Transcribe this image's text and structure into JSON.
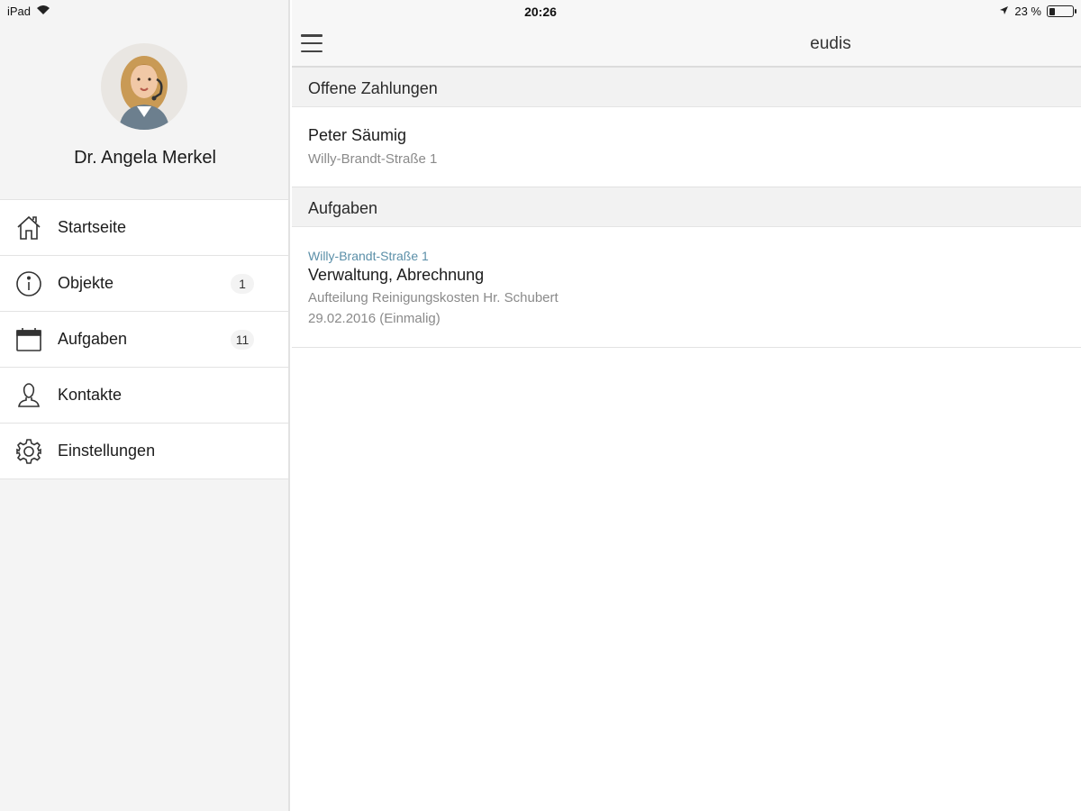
{
  "status_bar": {
    "device": "iPad",
    "time": "20:26",
    "battery_percent": "23 %",
    "battery_level": 0.23
  },
  "sidebar": {
    "profile_name": "Dr. Angela Merkel",
    "items": [
      {
        "label": "Startseite",
        "icon": "home-icon",
        "badge": ""
      },
      {
        "label": "Objekte",
        "icon": "info-icon",
        "badge": "1"
      },
      {
        "label": "Aufgaben",
        "icon": "calendar-icon",
        "badge": "11"
      },
      {
        "label": "Kontakte",
        "icon": "person-icon",
        "badge": ""
      },
      {
        "label": "Einstellungen",
        "icon": "gear-icon",
        "badge": ""
      }
    ]
  },
  "navbar": {
    "title": "eudis",
    "menu_icon": "hamburger-icon"
  },
  "sections": {
    "payments": {
      "header": "Offene Zahlungen",
      "items": [
        {
          "title": "Peter Säumig",
          "subtitle": "Willy-Brandt-Straße 1"
        }
      ]
    },
    "tasks": {
      "header": "Aufgaben",
      "items": [
        {
          "location": "Willy-Brandt-Straße 1",
          "title": "Verwaltung, Abrechnung",
          "description": "Aufteilung Reinigungskosten Hr. Schubert",
          "date": "29.02.2016 (Einmalig)"
        }
      ]
    }
  },
  "colors": {
    "link_blue": "#5b8fa8",
    "sidebar_bg": "#f4f4f4"
  }
}
